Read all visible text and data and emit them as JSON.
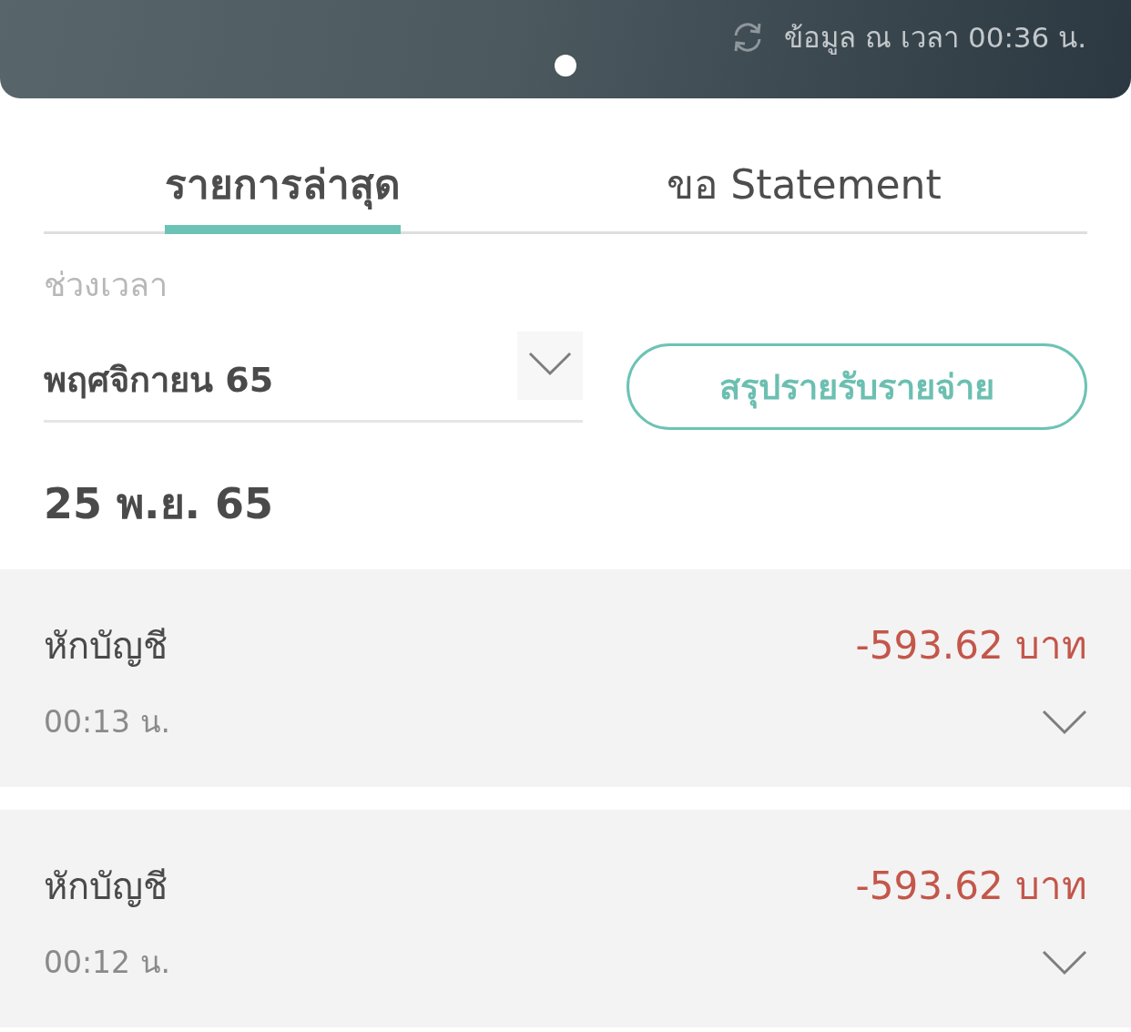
{
  "header": {
    "updated_text": "ข้อมูล ณ เวลา 00:36 น.",
    "page_dots": [
      {
        "selected": true
      }
    ]
  },
  "tabs": [
    {
      "label": "รายการล่าสุด",
      "selected": true
    },
    {
      "label": "ขอ Statement",
      "selected": false
    }
  ],
  "filter": {
    "label": "ช่วงเวลา",
    "period": {
      "value": "พฤศจิกายน 65",
      "expanded": false
    },
    "summary_button": "สรุปรายรับรายจ่าย"
  },
  "date_heading": "25 พ.ย. 65",
  "transactions": [
    {
      "title": "หักบัญชี",
      "amount": "-593.62 บาท",
      "time": "00:13 น.",
      "expanded": false
    },
    {
      "title": "หักบัญชี",
      "amount": "-593.62 บาท",
      "time": "00:12 น.",
      "expanded": false
    }
  ]
}
